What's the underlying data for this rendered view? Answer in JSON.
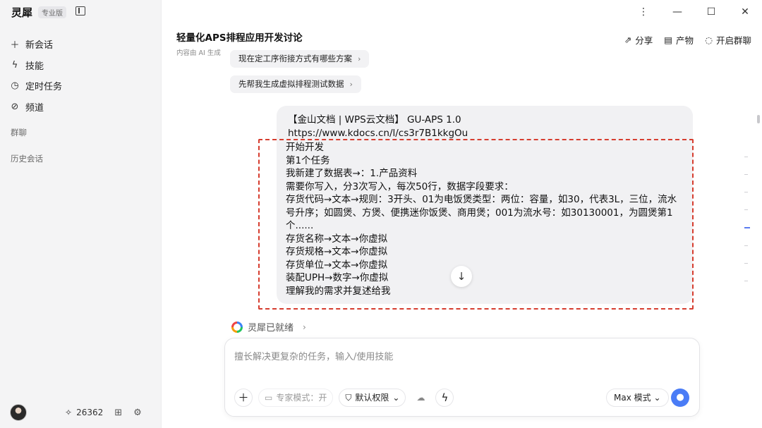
{
  "app": {
    "name": "灵犀",
    "edition": "专业版"
  },
  "sidebar": {
    "items": [
      {
        "icon": "plus-icon",
        "label": "新会话"
      },
      {
        "icon": "bolt-icon",
        "label": "技能"
      },
      {
        "icon": "clock-icon",
        "label": "定时任务"
      },
      {
        "icon": "link-icon",
        "label": "频道"
      }
    ],
    "sections": {
      "group_chat": "群聊",
      "history": "历史会话"
    },
    "footer": {
      "points": "26362"
    }
  },
  "header": {
    "title": "轻量化APS排程应用开发讨论",
    "subtitle": "内容由 AI 生成",
    "actions": {
      "share": "分享",
      "artifacts": "产物",
      "group_chat": "开启群聊"
    }
  },
  "suggestions": [
    "现在定工序衔接方式有哪些方案",
    "先帮我生成虚拟排程测试数据"
  ],
  "message": {
    "head_lines": [
      "【金山文档 | WPS云文档】 GU-APS 1.0",
      "https://www.kdocs.cn/l/cs3r7B1kkgOu"
    ],
    "body_lines": [
      "开始开发",
      "第1个任务",
      "我新建了数据表→：1.产品资料",
      "需要你写入，分3次写入，每次50行，数据字段要求：",
      "存货代码→文本→规则：3开头、01为电饭煲类型：两位：容量，如30，代表3L，三位，流水",
      "号升序；如圆煲、方煲、便携迷你饭煲、商用煲；001为流水号：如30130001，为圆煲第1",
      "个......",
      "存货名称→文本→你虚拟",
      "存货规格→文本→你虚拟",
      "存货单位→文本→你虚拟",
      "装配UPH→数字→你虚拟",
      "理解我的需求并复述给我"
    ]
  },
  "status": {
    "text": "灵犀已就绪"
  },
  "composer": {
    "placeholder": "擅长解决更复杂的任务，输入/使用技能",
    "expert_mode": "专家模式：开",
    "permission": "默认权限",
    "model": "Max 模式"
  },
  "colors": {
    "accent": "#4a7cf6",
    "highlight_border": "#d63d2f"
  }
}
